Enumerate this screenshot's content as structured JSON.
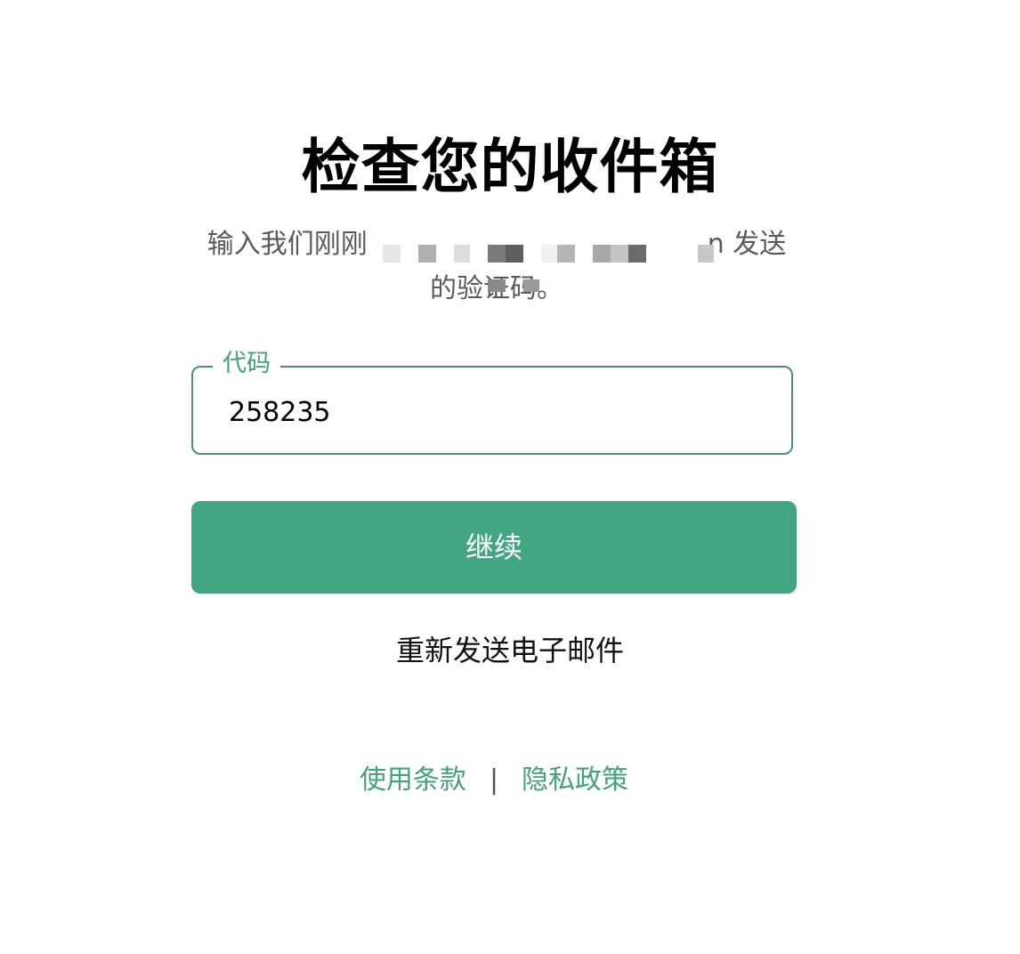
{
  "page": {
    "title": "检查您的收件箱",
    "subtitle_line1_start": "输入我们刚刚",
    "subtitle_line1_end": "n 发送",
    "subtitle_line2": "的验证码。"
  },
  "form": {
    "code_label": "代码",
    "code_value": "258235",
    "continue_label": "继续",
    "resend_label": "重新发送电子邮件"
  },
  "footer": {
    "terms_label": "使用条款",
    "separator": "|",
    "privacy_label": "隐私政策"
  },
  "colors": {
    "accent": "#42a682",
    "link": "#42a27d",
    "field_border": "#4a8f82"
  }
}
